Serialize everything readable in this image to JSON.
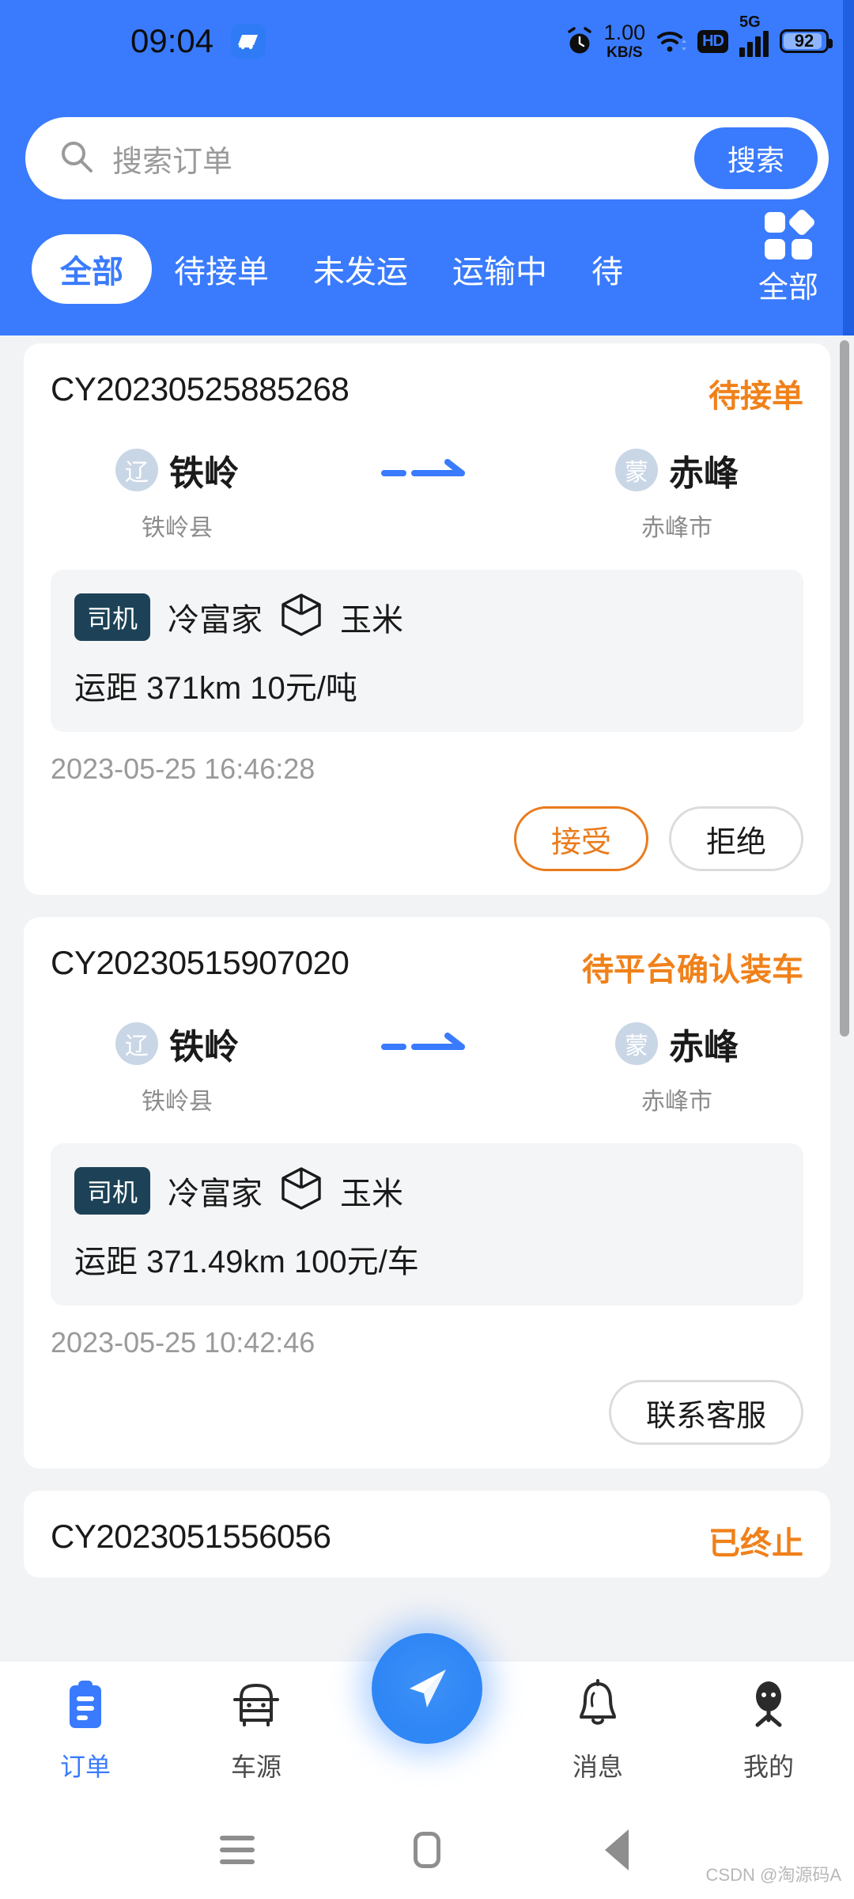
{
  "statusbar": {
    "time": "09:04",
    "app_icon": "truck-icon",
    "alarm_icon": "alarm-clock-icon",
    "net_speed_value": "1.00",
    "net_speed_unit": "KB/S",
    "wifi_icon": "wifi-icon",
    "hd_label": "HD",
    "network_type": "5G",
    "signal_icon": "signal-bars-icon",
    "battery_level": "92"
  },
  "search": {
    "icon": "search-icon",
    "placeholder": "搜索订单",
    "value": "",
    "button_label": "搜索"
  },
  "tabs": {
    "items": [
      {
        "label": "全部",
        "active": true
      },
      {
        "label": "待接单",
        "active": false
      },
      {
        "label": "未发运",
        "active": false
      },
      {
        "label": "运输中",
        "active": false
      },
      {
        "label": "待",
        "active": false
      }
    ],
    "filter": {
      "icon": "grid-icon",
      "label": "全部"
    }
  },
  "orders": [
    {
      "order_no": "CY20230525885268",
      "status": "待接单",
      "from": {
        "province": "辽",
        "city": "铁岭",
        "district": "铁岭县"
      },
      "to": {
        "province": "蒙",
        "city": "赤峰",
        "district": "赤峰市"
      },
      "route_icon": "dashed-arrow-icon",
      "driver_badge": "司机",
      "driver_name": "冷富家",
      "cargo_icon": "box-icon",
      "cargo": "玉米",
      "distance_price": "运距 371km  10元/吨",
      "timestamp": "2023-05-25 16:46:28",
      "buttons": [
        {
          "label": "接受",
          "style": "accept"
        },
        {
          "label": "拒绝",
          "style": "reject"
        }
      ]
    },
    {
      "order_no": "CY20230515907020",
      "status": "待平台确认装车",
      "from": {
        "province": "辽",
        "city": "铁岭",
        "district": "铁岭县"
      },
      "to": {
        "province": "蒙",
        "city": "赤峰",
        "district": "赤峰市"
      },
      "route_icon": "dashed-arrow-icon",
      "driver_badge": "司机",
      "driver_name": "冷富家",
      "cargo_icon": "box-icon",
      "cargo": "玉米",
      "distance_price": "运距 371.49km  100元/车",
      "timestamp": "2023-05-25 10:42:46",
      "buttons": [
        {
          "label": "联系客服",
          "style": "service"
        }
      ]
    },
    {
      "order_no": "CY2023051556056\u0000",
      "status": "已终止"
    }
  ],
  "partial_order": {
    "order_no": "CY2023051556056",
    "status": "已终止"
  },
  "bottomnav": {
    "items": [
      {
        "label": "订单",
        "icon": "clipboard-icon",
        "active": true
      },
      {
        "label": "车源",
        "icon": "truck-front-icon",
        "active": false
      },
      {
        "label": "消息",
        "icon": "bell-icon",
        "active": false
      },
      {
        "label": "我的",
        "icon": "person-icon",
        "active": false
      }
    ],
    "fab_icon": "send-plane-icon"
  },
  "androidnav": {
    "recents_icon": "hamburger-icon",
    "home_icon": "home-square-icon",
    "back_icon": "back-triangle-icon"
  },
  "watermark": "CSDN @淘源码A",
  "colors": {
    "brand_blue": "#3a7bfd",
    "status_orange": "#f0811a",
    "accept_orange": "#ea7b1d",
    "driver_badge": "#1d4257",
    "page_bg": "#f2f3f5"
  }
}
